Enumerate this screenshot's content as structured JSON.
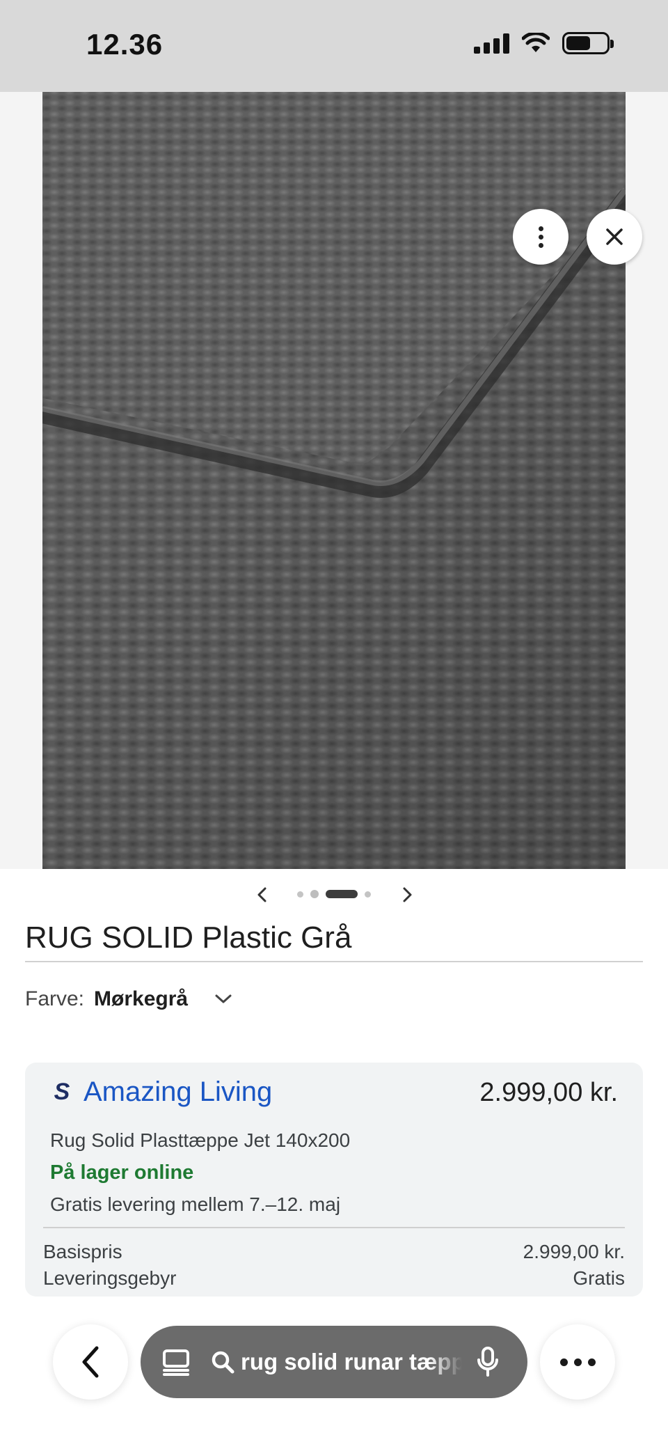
{
  "status_bar": {
    "time": "12.36",
    "icons": [
      "signal-icon",
      "wifi-icon",
      "battery-icon"
    ]
  },
  "image_viewer": {
    "image_description_icon": "rug-photo",
    "more_icon": "more-vert-icon",
    "close_icon": "close-icon",
    "carousel": {
      "count": 4,
      "active_index": 2
    }
  },
  "product": {
    "title": "RUG SOLID Plastic Grå",
    "color_label": "Farve:",
    "color_value": "Mørkegrå"
  },
  "offer": {
    "seller_logo": "S",
    "seller_name": "Amazing Living",
    "price": "2.999,00 kr.",
    "product_name": "Rug Solid Plasttæppe Jet 140x200",
    "stock": "På lager online",
    "delivery": "Gratis levering mellem 7.–12. maj",
    "base_price_label": "Basispris",
    "base_price_value": "2.999,00 kr.",
    "shipping_label": "Leveringsgebyr",
    "shipping_value": "Gratis"
  },
  "browser_bar": {
    "search_query": "rug solid runar tæppe",
    "colors": {
      "pill": "#6b6b6b",
      "accent_link": "#1a56c4",
      "stock": "#1e7a32"
    }
  }
}
